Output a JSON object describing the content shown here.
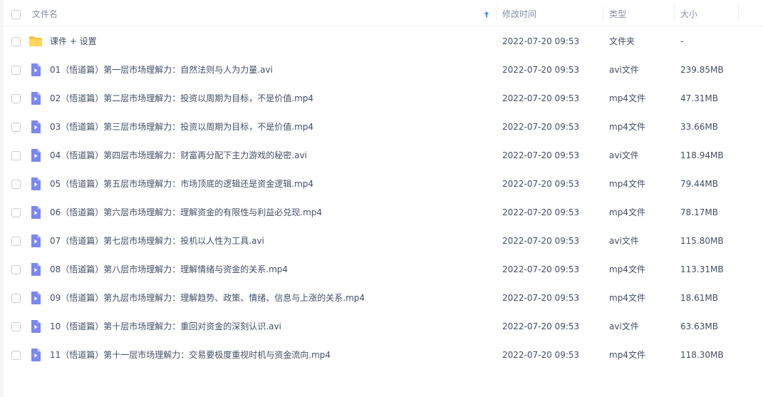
{
  "header": {
    "name": "文件名",
    "modified": "修改时间",
    "type": "类型",
    "size": "大小"
  },
  "icons": {
    "folder": "folder-icon",
    "video": "video-file-icon",
    "sort": "sort-ascending-icon"
  },
  "colors": {
    "folder": "#ffd659",
    "folder_back": "#f8c13a",
    "video": "#7b87f0",
    "video_fold": "#b2baf7",
    "sort_arrow": "#4a8ffb"
  },
  "files": [
    {
      "kind": "folder",
      "name": "课件 + 设置",
      "modified": "2022-07-20 09:53",
      "type": "文件夹",
      "size": "-"
    },
    {
      "kind": "video",
      "name": "01（悟道篇）第一层市场理解力：自然法则与人为力量.avi",
      "modified": "2022-07-20 09:53",
      "type": "avi文件",
      "size": "239.85MB"
    },
    {
      "kind": "video",
      "name": "02（悟道篇）第二层市场理解力：投资以周期为目标，不是价值.mp4",
      "modified": "2022-07-20 09:53",
      "type": "mp4文件",
      "size": "47.31MB"
    },
    {
      "kind": "video",
      "name": "03（悟道篇）第三层市场理解力：投资以周期为目标，不是价值.mp4",
      "modified": "2022-07-20 09:53",
      "type": "mp4文件",
      "size": "33.66MB"
    },
    {
      "kind": "video",
      "name": "04（悟道篇）第四层市场理解力：财富再分配下主力游戏的秘密.avi",
      "modified": "2022-07-20 09:53",
      "type": "avi文件",
      "size": "118.94MB"
    },
    {
      "kind": "video",
      "name": "05（悟道篇）第五层市场理解力：市场顶底的逻辑还是资金逻辑.mp4",
      "modified": "2022-07-20 09:53",
      "type": "mp4文件",
      "size": "79.44MB"
    },
    {
      "kind": "video",
      "name": "06（悟道篇）第六层市场理解力：理解资金的有限性与利益必兑现.mp4",
      "modified": "2022-07-20 09:53",
      "type": "mp4文件",
      "size": "78.17MB"
    },
    {
      "kind": "video",
      "name": "07（悟道篇）第七层市场理解力：投机以人性为工具.avi",
      "modified": "2022-07-20 09:53",
      "type": "avi文件",
      "size": "115.80MB"
    },
    {
      "kind": "video",
      "name": "08（悟道篇）第八层市场理解力：理解情绪与资金的关系.mp4",
      "modified": "2022-07-20 09:53",
      "type": "mp4文件",
      "size": "113.31MB"
    },
    {
      "kind": "video",
      "name": "09（悟道篇）第九层市场理解力：理解趋势、政策、情绪、信息与上涨的关系.mp4",
      "modified": "2022-07-20 09:53",
      "type": "mp4文件",
      "size": "18.61MB"
    },
    {
      "kind": "video",
      "name": "10（悟道篇）第十层市场理解力：重回对资金的深刻认识.avi",
      "modified": "2022-07-20 09:53",
      "type": "avi文件",
      "size": "63.63MB"
    },
    {
      "kind": "video",
      "name": "11（悟道篇）第十一层市场理解力：交易要极度重视时机与资金流向.mp4",
      "modified": "2022-07-20 09:53",
      "type": "mp4文件",
      "size": "118.30MB"
    }
  ]
}
